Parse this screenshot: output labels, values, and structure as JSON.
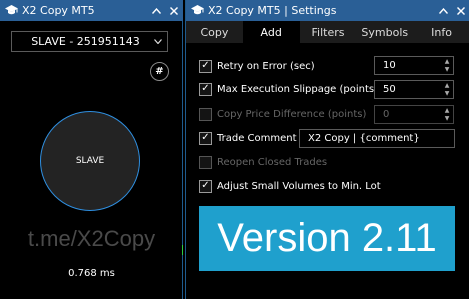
{
  "left_window": {
    "title": "X2 Copy MT5",
    "account_select": "SLAVE - 251951143",
    "hash_label": "#",
    "mode_label": "SLAVE",
    "watermark": "t.me/X2Copy",
    "latency": "0.768 ms"
  },
  "right_window": {
    "title": "X2 Copy MT5 | Settings",
    "tabs": [
      {
        "label": "Copy"
      },
      {
        "label": "Add"
      },
      {
        "label": "Filters"
      },
      {
        "label": "Symbols"
      },
      {
        "label": "Info"
      }
    ],
    "active_tab": "Add",
    "options": {
      "retry_on_error": {
        "label": "Retry on Error (sec)",
        "checked": true,
        "value": "10"
      },
      "max_slippage": {
        "label": "Max Execution Slippage (points)",
        "checked": true,
        "value": "50"
      },
      "copy_price_diff": {
        "label": "Copy Price Difference (points)",
        "checked": false,
        "value": "0"
      },
      "trade_comment": {
        "label": "Trade Comment",
        "checked": true,
        "value": "X2 Copy | {comment}"
      },
      "reopen_closed": {
        "label": "Reopen Closed Trades",
        "checked": false
      },
      "adjust_small_volumes": {
        "label": "Adjust Small Volumes to Min. Lot",
        "checked": true
      }
    },
    "version_banner": "Version 2.11"
  },
  "icons": {
    "window_icon": "graduation-cap-icon",
    "collapse": "chevron-up-icon",
    "close": "close-icon",
    "dropdown": "chevron-down-icon",
    "checkmark": "check-icon"
  },
  "colors": {
    "titlebar": "#2a5f96",
    "circle_border": "#2f8fe0",
    "version_banner": "#1fa0cd"
  }
}
